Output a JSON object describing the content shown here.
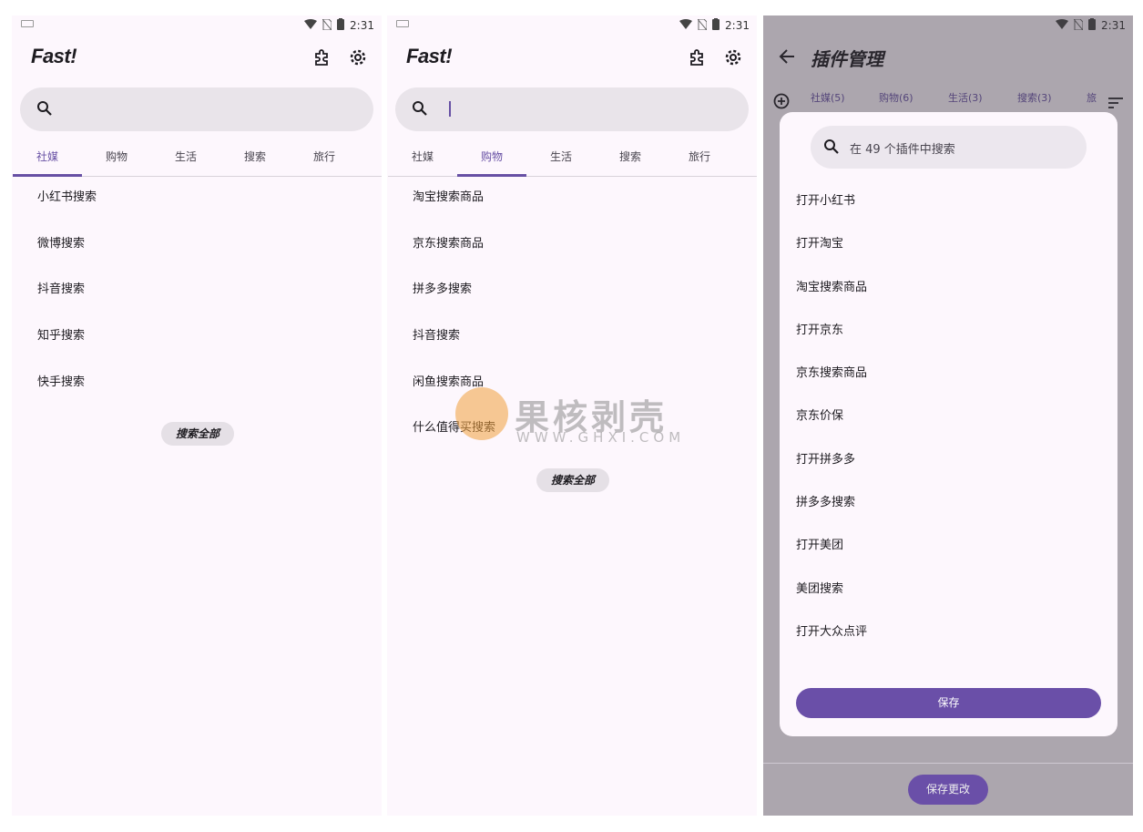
{
  "status": {
    "time": "2:31"
  },
  "screen1": {
    "app_title": "Fast!",
    "tabs": [
      "社媒",
      "购物",
      "生活",
      "搜索",
      "旅行"
    ],
    "active_tab": 0,
    "items": [
      "小红书搜索",
      "微博搜索",
      "抖音搜索",
      "知乎搜索",
      "快手搜索"
    ],
    "search_all": "搜索全部"
  },
  "screen2": {
    "app_title": "Fast!",
    "tabs": [
      "社媒",
      "购物",
      "生活",
      "搜索",
      "旅行"
    ],
    "active_tab": 1,
    "items": [
      "淘宝搜索商品",
      "京东搜索商品",
      "拼多多搜索",
      "抖音搜索",
      "闲鱼搜索商品",
      "什么值得买搜索"
    ],
    "search_all": "搜索全部"
  },
  "screen3": {
    "title": "插件管理",
    "tabs": [
      "社媒(5)",
      "购物(6)",
      "生活(3)",
      "搜索(3)",
      "旅"
    ],
    "dialog": {
      "search_placeholder": "在 49 个插件中搜索",
      "items": [
        "打开小红书",
        "打开淘宝",
        "淘宝搜索商品",
        "打开京东",
        "京东搜索商品",
        "京东价保",
        "打开拼多多",
        "拼多多搜索",
        "打开美团",
        "美团搜索",
        "打开大众点评"
      ],
      "save": "保存"
    },
    "save_changes": "保存更改"
  },
  "watermark": {
    "text": "果核剥壳",
    "url": "WWW.GHXI.COM"
  },
  "colors": {
    "accent": "#6750a4",
    "background": "#fdf7fd"
  }
}
